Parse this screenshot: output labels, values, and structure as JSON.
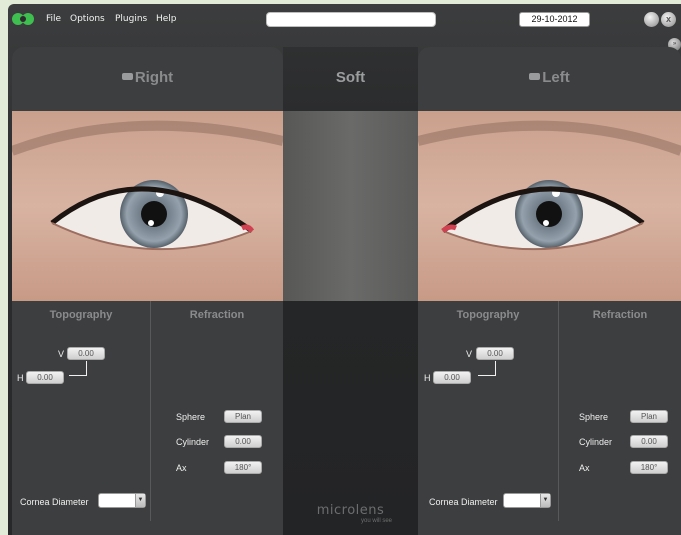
{
  "menu": [
    "File",
    "Options",
    "Plugins",
    "Help"
  ],
  "search": {
    "value": ""
  },
  "date": "29-10-2012",
  "window_buttons": {
    "minimize": "",
    "close": "x"
  },
  "extra_button": "»",
  "center": {
    "title": "Soft",
    "brand": "microlens",
    "tagline": "you will see"
  },
  "right_panel": {
    "title": "Right",
    "topography": {
      "heading": "Topography",
      "v_label": "V",
      "v_value": "0.00",
      "h_label": "H",
      "h_value": "0.00"
    },
    "refraction": {
      "heading": "Refraction",
      "rows": [
        {
          "label": "Sphere",
          "value": "Plan"
        },
        {
          "label": "Cylinder",
          "value": "0.00"
        },
        {
          "label": "Ax",
          "value": "180°"
        }
      ]
    },
    "cornea": {
      "label": "Cornea Diameter",
      "value": ""
    }
  },
  "left_panel": {
    "title": "Left",
    "topography": {
      "heading": "Topography",
      "v_label": "V",
      "v_value": "0.00",
      "h_label": "H",
      "h_value": "0.00"
    },
    "refraction": {
      "heading": "Refraction",
      "rows": [
        {
          "label": "Sphere",
          "value": "Plan"
        },
        {
          "label": "Cylinder",
          "value": "0.00"
        },
        {
          "label": "Ax",
          "value": "180°"
        }
      ]
    },
    "cornea": {
      "label": "Cornea Diameter",
      "value": ""
    }
  },
  "colors": {
    "accent_green": "#3fbf4f",
    "panel": "#3d3e3f",
    "frame": "#e2ead8"
  }
}
